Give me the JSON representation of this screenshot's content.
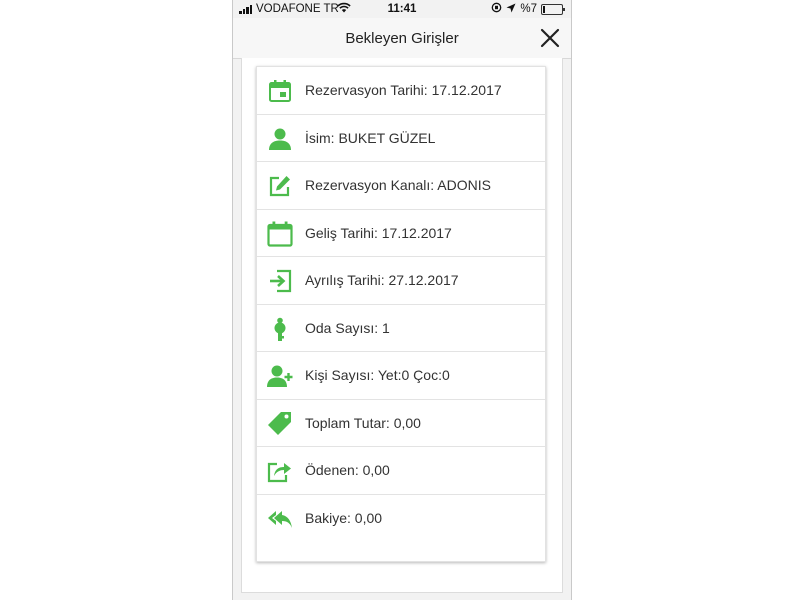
{
  "status_bar": {
    "carrier": "VODAFONE TR",
    "time": "11:41",
    "battery": "%7"
  },
  "header": {
    "title": "Bekleyen Girişler"
  },
  "accent_color": "#4cbb4c",
  "rows": [
    {
      "icon": "calendar-icon",
      "text": "Rezervasyon Tarihi: 17.12.2017"
    },
    {
      "icon": "user-icon",
      "text": "İsim: BUKET GÜZEL"
    },
    {
      "icon": "edit-icon",
      "text": "Rezervasyon Kanalı: ADONIS"
    },
    {
      "icon": "calendar-arrival-icon",
      "text": "Geliş Tarihi: 17.12.2017"
    },
    {
      "icon": "sign-in-icon",
      "text": "Ayrılış Tarihi: 27.12.2017"
    },
    {
      "icon": "key-icon",
      "text": "Oda Sayısı: 1"
    },
    {
      "icon": "user-plus-icon",
      "text": "Kişi Sayısı: Yet:0 Çoc:0"
    },
    {
      "icon": "tag-icon",
      "text": "Toplam Tutar: 0,00"
    },
    {
      "icon": "share-icon",
      "text": "Ödenen: 0,00"
    },
    {
      "icon": "reply-all-icon",
      "text": "Bakiye: 0,00"
    }
  ]
}
